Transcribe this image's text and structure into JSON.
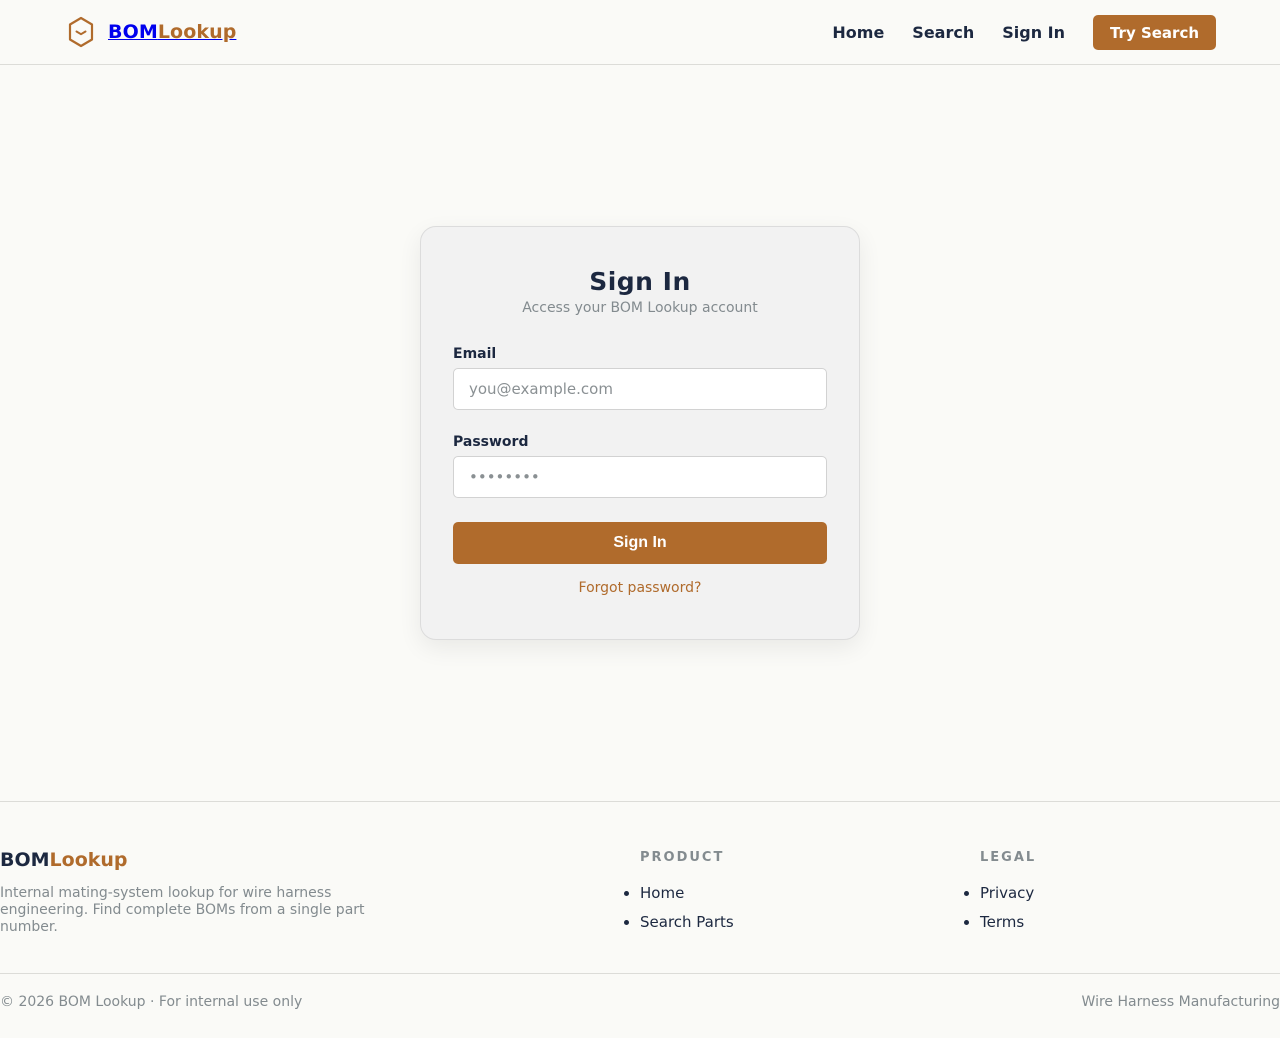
{
  "header": {
    "brand": {
      "part1": "BOM",
      "part2": "Lookup"
    },
    "nav": [
      {
        "label": "Home"
      },
      {
        "label": "Search"
      },
      {
        "label": "Sign In"
      }
    ],
    "cta_label": "Try Search"
  },
  "signin": {
    "title": "Sign In",
    "subtitle": "Access your BOM Lookup account",
    "email_label": "Email",
    "email_placeholder": "you@example.com",
    "password_label": "Password",
    "password_placeholder": "••••••••",
    "submit_label": "Sign In",
    "forgot_label": "Forgot password?"
  },
  "footer": {
    "brand": {
      "part1": "BOM",
      "part2": "Lookup"
    },
    "description": "Internal mating-system lookup for wire harness engineering. Find complete BOMs from a single part number.",
    "product": {
      "title": "PRODUCT",
      "links": [
        "Home",
        "Search Parts"
      ]
    },
    "legal": {
      "title": "LEGAL",
      "links": [
        "Privacy",
        "Terms"
      ]
    },
    "copyright": "© 2026 BOM Lookup · For internal use only",
    "tagline": "Wire Harness Manufacturing"
  },
  "colors": {
    "accent": "#b06b2c",
    "navy": "#1c2840",
    "muted": "#838b8f",
    "background": "#fafaf7"
  },
  "icons": {
    "logo": "hexagon-logo-icon"
  }
}
